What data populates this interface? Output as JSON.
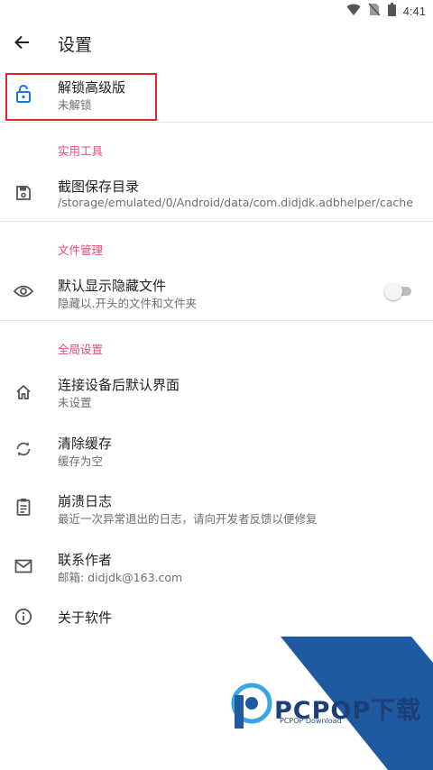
{
  "status_bar": {
    "time": "4:41"
  },
  "header": {
    "title": "设置",
    "back_icon": "arrow-back-icon"
  },
  "unlock": {
    "title": "解锁高级版",
    "subtitle": "未解锁",
    "icon": "lock-open-icon"
  },
  "sections": {
    "tools": "实用工具",
    "files": "文件管理",
    "global": "全局设置"
  },
  "screenshot_dir": {
    "title": "截图保存目录",
    "subtitle": "/storage/emulated/0/Android/data/com.didjdk.adbhelper/cache",
    "icon": "save-icon"
  },
  "hidden_files": {
    "title": "默认显示隐藏文件",
    "subtitle": "隐藏以.开头的文件和文件夹",
    "icon": "eye-icon",
    "enabled": false
  },
  "default_screen": {
    "title": "连接设备后默认界面",
    "subtitle": "未设置",
    "icon": "home-icon"
  },
  "clear_cache": {
    "title": "清除缓存",
    "subtitle": "缓存为空",
    "icon": "sync-icon"
  },
  "crash_log": {
    "title": "崩溃日志",
    "subtitle": "最近一次异常退出的日志，请向开发者反馈以便修复",
    "icon": "clipboard-icon"
  },
  "contact": {
    "title": "联系作者",
    "subtitle": "邮箱: didjdk@163.com",
    "icon": "mail-icon"
  },
  "about": {
    "title": "关于软件",
    "icon": "info-icon"
  },
  "watermark": {
    "brand": "PCPOP下载",
    "sub": "PCPOP Download",
    "color": "#1f5aa0"
  }
}
